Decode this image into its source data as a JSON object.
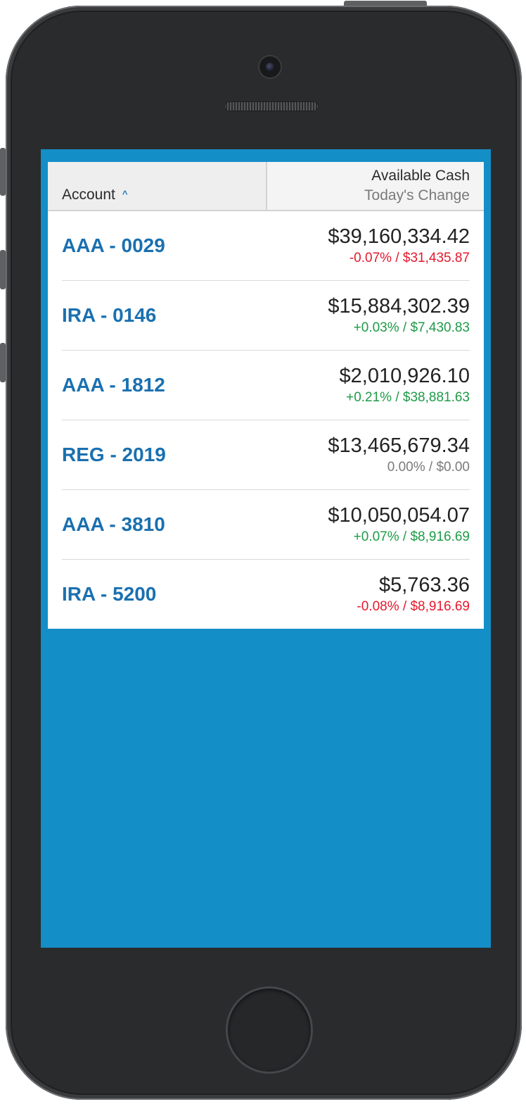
{
  "table": {
    "header": {
      "account_label": "Account",
      "sort_indicator": "^",
      "cash_label": "Available Cash",
      "change_label": "Today's Change"
    },
    "rows": [
      {
        "account": "AAA - 0029",
        "cash": "$39,160,334.42",
        "change": "-0.07% / $31,435.87",
        "trend": "negative"
      },
      {
        "account": "IRA - 0146",
        "cash": "$15,884,302.39",
        "change": "+0.03% / $7,430.83",
        "trend": "positive"
      },
      {
        "account": "AAA - 1812",
        "cash": "$2,010,926.10",
        "change": "+0.21% / $38,881.63",
        "trend": "positive"
      },
      {
        "account": "REG - 2019",
        "cash": "$13,465,679.34",
        "change": "0.00% / $0.00",
        "trend": "flat"
      },
      {
        "account": "AAA - 3810",
        "cash": "$10,050,054.07",
        "change": "+0.07% / $8,916.69",
        "trend": "positive"
      },
      {
        "account": "IRA - 5200",
        "cash": "$5,763.36",
        "change": "-0.08% / $8,916.69",
        "trend": "negative"
      }
    ]
  },
  "colors": {
    "screen_background": "#148ec7",
    "link": "#1a70b0",
    "negative": "#e5182c",
    "positive": "#1d9b47",
    "flat": "#7a7a7a"
  },
  "icons": {
    "sort": "caret-up-icon"
  }
}
